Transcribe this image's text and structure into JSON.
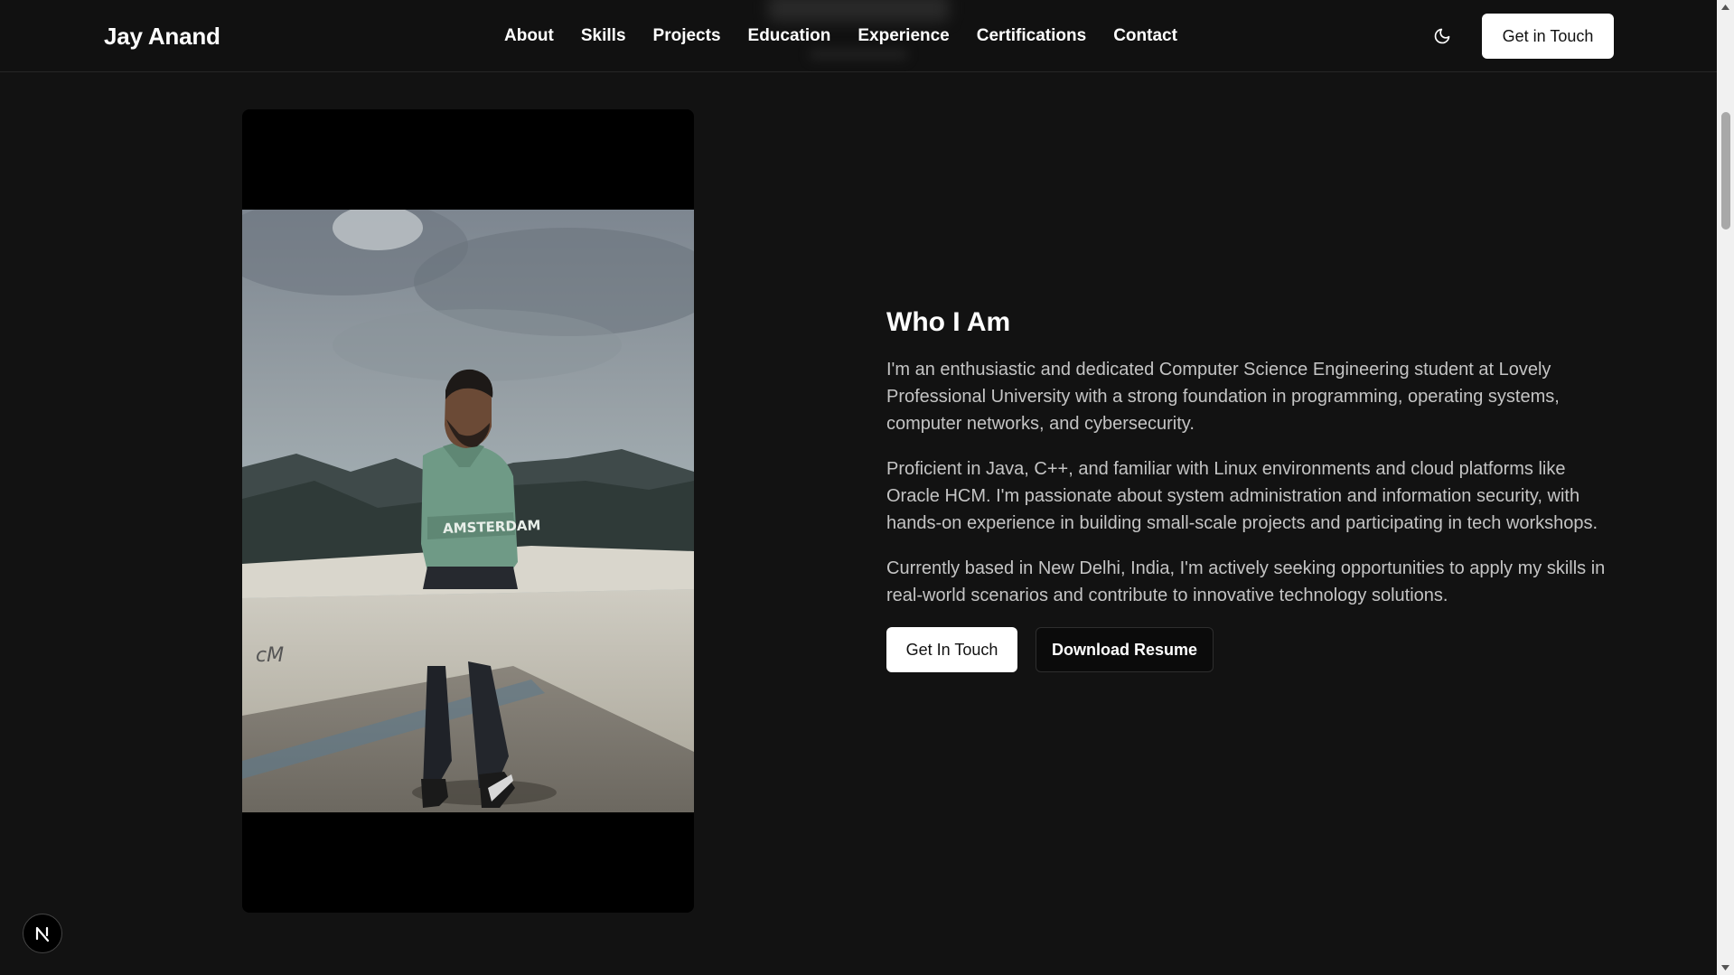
{
  "header": {
    "logo": "Jay Anand",
    "nav": [
      "About",
      "Skills",
      "Projects",
      "Education",
      "Experience",
      "Certifications",
      "Contact"
    ],
    "theme_icon": "moon-icon",
    "cta": "Get in Touch"
  },
  "about": {
    "heading": "Who I Am",
    "paragraphs": [
      "I'm an enthusiastic and dedicated Computer Science Engineering student at Lovely Professional University with a strong foundation in programming, operating systems, computer networks, and cybersecurity.",
      "Proficient in Java, C++, and familiar with Linux environments and cloud platforms like Oracle HCM. I'm passionate about system administration and information security, with hands-on experience in building small-scale projects and participating in tech workshops.",
      "Currently based in New Delhi, India, I'm actively seeking opportunities to apply my skills in real-world scenarios and contribute to innovative technology solutions."
    ],
    "primary_button": "Get In Touch",
    "secondary_button": "Download Resume"
  },
  "photo": {
    "sweater_text": "AMSTERDAM"
  },
  "badge": {
    "label": "N"
  },
  "colors": {
    "background": "#121212",
    "header": "#111111",
    "text_muted": "#c4c4c4",
    "button_light": "#ffffff"
  }
}
